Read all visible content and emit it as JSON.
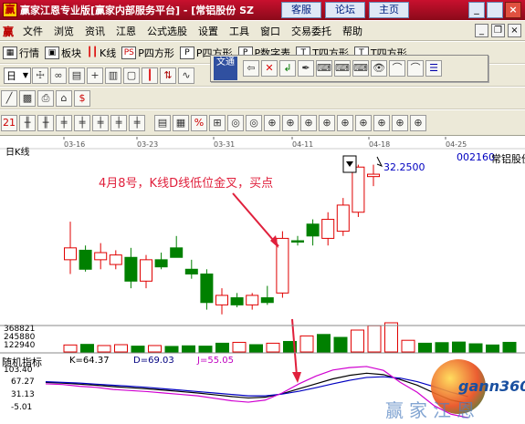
{
  "window": {
    "title": "赢家江恩专业版[赢家内部服务平台] - [常铝股份 SZ",
    "btn_service": "客服",
    "btn_forum": "论坛",
    "btn_home": "主页"
  },
  "menu": [
    "文件",
    "浏览",
    "资讯",
    "江恩",
    "公式选股",
    "设置",
    "工具",
    "窗口",
    "交易委托",
    "帮助"
  ],
  "toolbar1": {
    "market": "行情",
    "sector": "板块",
    "kline": "K线",
    "p_square": "P四方形",
    "hidden1": "P四方形",
    "hidden2": "P数字表",
    "hidden3": "T四方形",
    "hidden4": "T四方形"
  },
  "toolbar2": {
    "period": "日",
    "period_indicator": "文通"
  },
  "chart": {
    "period_label": "日K线",
    "stock_code": "002160",
    "stock_name": "常铝股份",
    "price_label": "32.2500",
    "dates": [
      "03-16",
      "03-23",
      "03-31",
      "04-11",
      "04-18",
      "04-25"
    ],
    "annotation": "4月8号，K线D线低位金叉，买点",
    "volume_ticks": [
      "368821",
      "245880",
      "122940"
    ],
    "indicator": {
      "name": "随机指标",
      "k": "K=64.37",
      "d": "D=69.03",
      "j": "J=55.05",
      "ticks": [
        "103.40",
        "67.27",
        "31.13",
        "-5.01"
      ]
    },
    "watermark": "赢家江恩",
    "watermark_brand": "gann360"
  },
  "chart_data": {
    "type": "candlestick",
    "candles": [
      {
        "o": 28.4,
        "h": 30.0,
        "l": 27.8,
        "c": 28.9,
        "color": "red"
      },
      {
        "o": 28.8,
        "h": 29.0,
        "l": 27.9,
        "c": 28.0,
        "color": "green"
      },
      {
        "o": 28.4,
        "h": 29.1,
        "l": 28.0,
        "c": 28.7,
        "color": "red"
      },
      {
        "o": 28.2,
        "h": 28.8,
        "l": 28.0,
        "c": 28.6,
        "color": "red"
      },
      {
        "o": 28.5,
        "h": 28.9,
        "l": 27.2,
        "c": 27.5,
        "color": "green"
      },
      {
        "o": 27.5,
        "h": 28.6,
        "l": 27.2,
        "c": 28.4,
        "color": "red"
      },
      {
        "o": 28.4,
        "h": 28.7,
        "l": 28.0,
        "c": 28.1,
        "color": "green"
      },
      {
        "o": 28.9,
        "h": 29.4,
        "l": 28.5,
        "c": 28.5,
        "color": "green"
      },
      {
        "o": 28.0,
        "h": 28.4,
        "l": 27.6,
        "c": 27.8,
        "color": "green"
      },
      {
        "o": 27.8,
        "h": 28.0,
        "l": 26.3,
        "c": 26.6,
        "color": "green"
      },
      {
        "o": 26.5,
        "h": 27.2,
        "l": 26.1,
        "c": 26.9,
        "color": "red"
      },
      {
        "o": 26.8,
        "h": 27.0,
        "l": 26.4,
        "c": 26.5,
        "color": "green"
      },
      {
        "o": 26.5,
        "h": 27.0,
        "l": 26.3,
        "c": 26.9,
        "color": "red"
      },
      {
        "o": 26.8,
        "h": 27.3,
        "l": 26.5,
        "c": 26.6,
        "color": "green"
      },
      {
        "o": 27.0,
        "h": 29.6,
        "l": 26.8,
        "c": 29.3,
        "color": "red"
      },
      {
        "o": 29.2,
        "h": 29.4,
        "l": 29.0,
        "c": 29.2,
        "color": "green"
      },
      {
        "o": 29.4,
        "h": 30.1,
        "l": 29.0,
        "c": 29.9,
        "color": "green"
      },
      {
        "o": 29.3,
        "h": 30.4,
        "l": 29.0,
        "c": 30.1,
        "color": "red"
      },
      {
        "o": 29.6,
        "h": 31.0,
        "l": 29.4,
        "c": 30.7,
        "color": "red"
      },
      {
        "o": 30.4,
        "h": 32.4,
        "l": 30.2,
        "c": 32.3,
        "color": "red"
      },
      {
        "o": 31.9,
        "h": 32.4,
        "l": 31.5,
        "c": 32.0,
        "color": "red"
      }
    ],
    "volumes": [
      0.24,
      0.26,
      0.22,
      0.25,
      0.2,
      0.22,
      0.19,
      0.21,
      0.2,
      0.3,
      0.33,
      0.25,
      0.3,
      0.36,
      0.55,
      0.6,
      0.5,
      0.75,
      0.9,
      1.0,
      0.4,
      0.3,
      0.32,
      0.34,
      0.28,
      0.24,
      0.33
    ],
    "kdj": {
      "k": [
        70,
        68,
        65,
        62,
        58,
        55,
        52,
        48,
        44,
        40,
        35,
        30,
        26,
        28,
        38,
        52,
        66,
        80,
        90,
        96,
        92,
        78,
        62,
        40,
        20,
        10
      ],
      "d": [
        72,
        70,
        68,
        65,
        62,
        59,
        56,
        52,
        48,
        44,
        40,
        36,
        32,
        32,
        37,
        45,
        55,
        66,
        76,
        84,
        86,
        82,
        72,
        58,
        42,
        30
      ],
      "j": [
        66,
        64,
        59,
        56,
        50,
        47,
        44,
        40,
        36,
        32,
        25,
        18,
        14,
        20,
        40,
        66,
        88,
        105,
        112,
        115,
        104,
        70,
        42,
        4,
        -20,
        -30
      ]
    }
  }
}
